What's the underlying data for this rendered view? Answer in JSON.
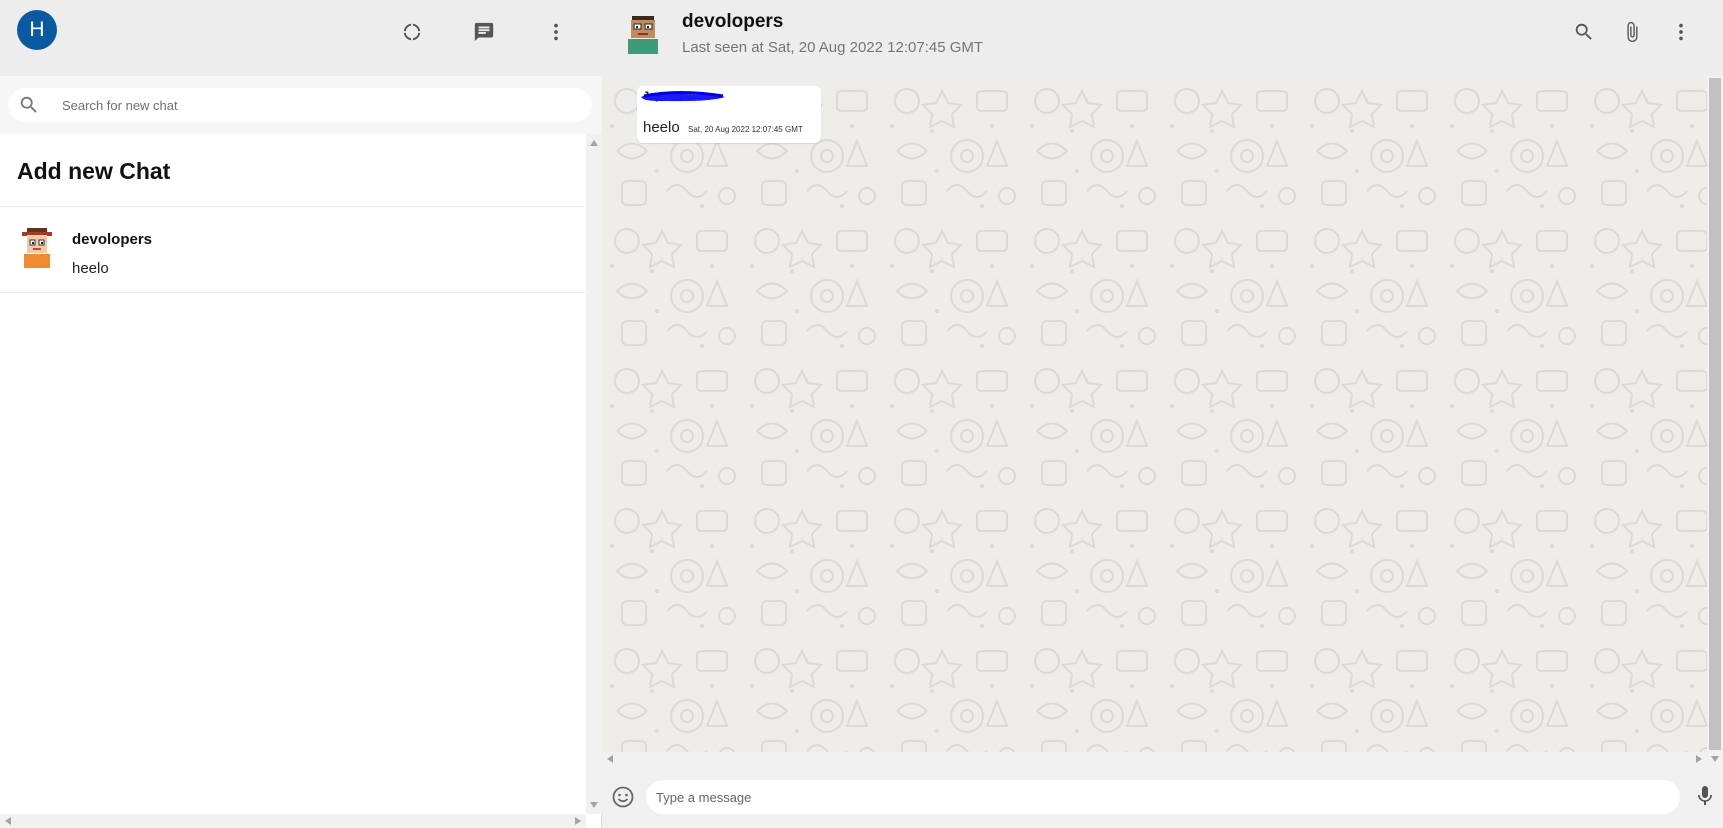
{
  "user": {
    "avatar_initial": "H",
    "avatar_color": "#0b5aa1"
  },
  "sidebar": {
    "header_icons": [
      "status-icon",
      "new-chat-icon",
      "more-vert-icon"
    ],
    "search": {
      "placeholder": "Search for new chat",
      "value": ""
    },
    "add_chat_label": "Add new Chat",
    "chats": [
      {
        "name": "devolopers",
        "last_message": "heelo"
      }
    ]
  },
  "chat": {
    "name": "devolopers",
    "status": "Last seen at Sat, 20 Aug 2022 12:07:45 GMT",
    "header_icons": [
      "search-icon",
      "attach-icon",
      "more-vert-icon"
    ],
    "messages": [
      {
        "sender": "Jaya Kumar",
        "text": "heelo",
        "time": "Sat, 20 Aug 2022 12:07:45 GMT",
        "sender_redacted": true
      }
    ],
    "input": {
      "placeholder": "Type a message",
      "value": ""
    }
  },
  "colors": {
    "header_bg": "#ededed",
    "chat_bg": "#efedea",
    "redaction": "#1a1aff"
  }
}
